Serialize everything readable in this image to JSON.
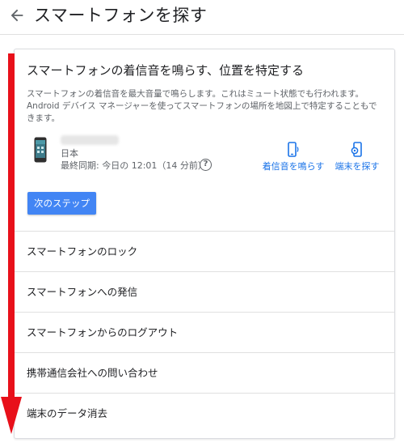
{
  "header": {
    "title": "スマートフォンを探す",
    "back_icon": "arrow-back-icon"
  },
  "card": {
    "title": "スマートフォンの着信音を鳴らす、位置を特定する",
    "description": "スマートフォンの着信音を最大音量で鳴らします。これはミュート状態でも行われます。Android デバイス マネージャーを使ってスマートフォンの場所を地図上で特定することもできます。",
    "device": {
      "country": "日本",
      "last_sync": "最終同期: 今日の 12:01（14 分前）"
    },
    "actions": {
      "ring_label": "着信音を鳴らす",
      "find_label": "端末を探す"
    },
    "next_button_label": "次のステップ"
  },
  "menu": {
    "items": [
      {
        "label": "スマートフォンのロック"
      },
      {
        "label": "スマートフォンへの発信"
      },
      {
        "label": "スマートフォンからのログアウト"
      },
      {
        "label": "携帯通信会社への問い合わせ"
      },
      {
        "label": "端末のデータ消去"
      }
    ]
  },
  "colors": {
    "accent": "#1a73e8",
    "button": "#4285f4",
    "annotation_arrow": "#e8101a"
  }
}
